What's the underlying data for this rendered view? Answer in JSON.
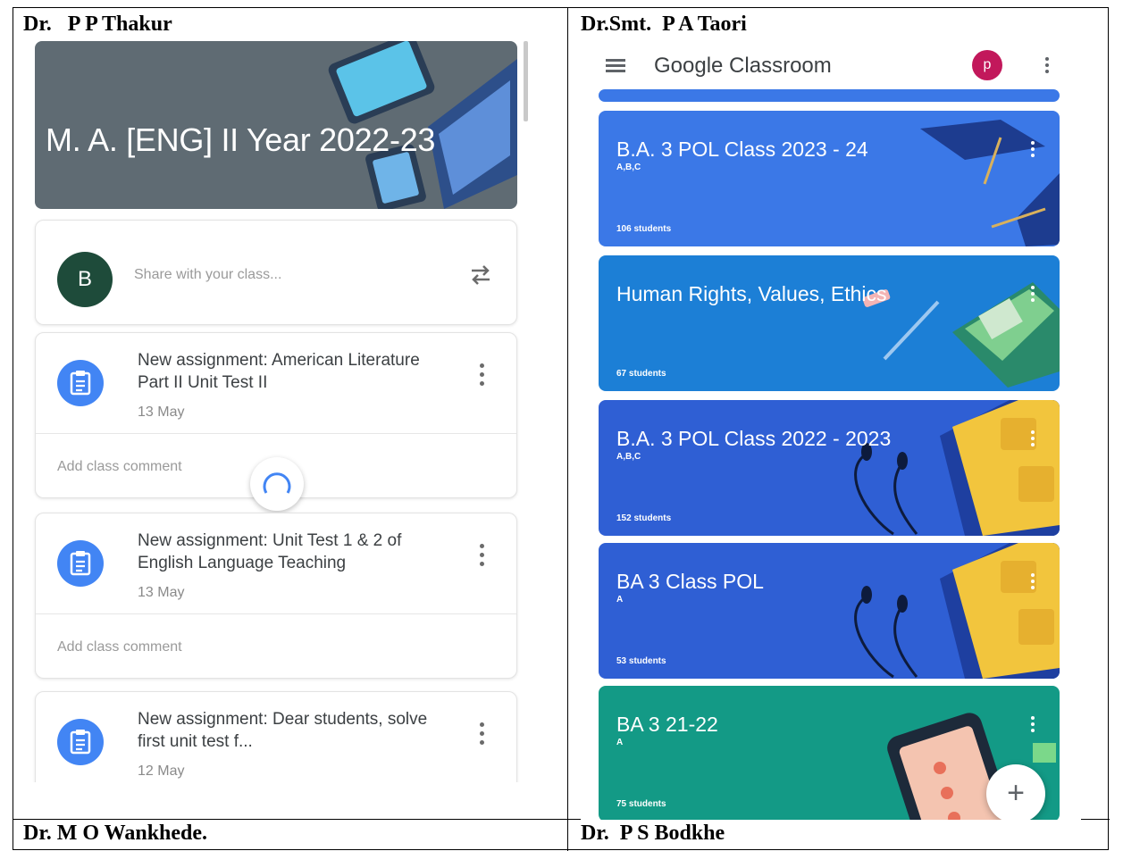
{
  "headers": {
    "top_left": "Dr.   P P Thakur",
    "top_right": "Dr.Smt.  P A Taori",
    "bottom_left": "Dr. M O Wankhede.",
    "bottom_right": "Dr.  P S Bodkhe"
  },
  "left_panel": {
    "class_title": "M. A. [ENG] II Year 2022-23",
    "share": {
      "avatar_letter": "B",
      "placeholder": "Share with your class..."
    },
    "assignments": [
      {
        "title": "New assignment: American Literature Part II Unit Test II",
        "date": "13 May",
        "comment": "Add class comment"
      },
      {
        "title": "New assignment: Unit Test 1 & 2 of English Language Teaching",
        "date": "13 May",
        "comment": "Add class comment"
      },
      {
        "title": "New assignment: Dear students, solve first unit test f...",
        "date": "12 May"
      }
    ]
  },
  "right_panel": {
    "app_title": "Google Classroom",
    "avatar_letter": "p",
    "classes": [
      {
        "name": "B.A. 3 POL Class 2023 - 24",
        "section": "A,B,C",
        "students": "106 students",
        "color": "#3b78e7"
      },
      {
        "name": "Human Rights, Values, Ethics",
        "section": "",
        "students": "67 students",
        "color": "#1c7fd6"
      },
      {
        "name": "B.A. 3 POL Class 2022 - 2023",
        "section": "A,B,C",
        "students": "152 students",
        "color": "#2f5fd4"
      },
      {
        "name": "BA 3 Class POL",
        "section": "A",
        "students": "53 students",
        "color": "#2f5fd4"
      },
      {
        "name": "BA 3 21-22",
        "section": "A",
        "students": "75 students",
        "color": "#139a86"
      }
    ],
    "fab_label": "+"
  }
}
